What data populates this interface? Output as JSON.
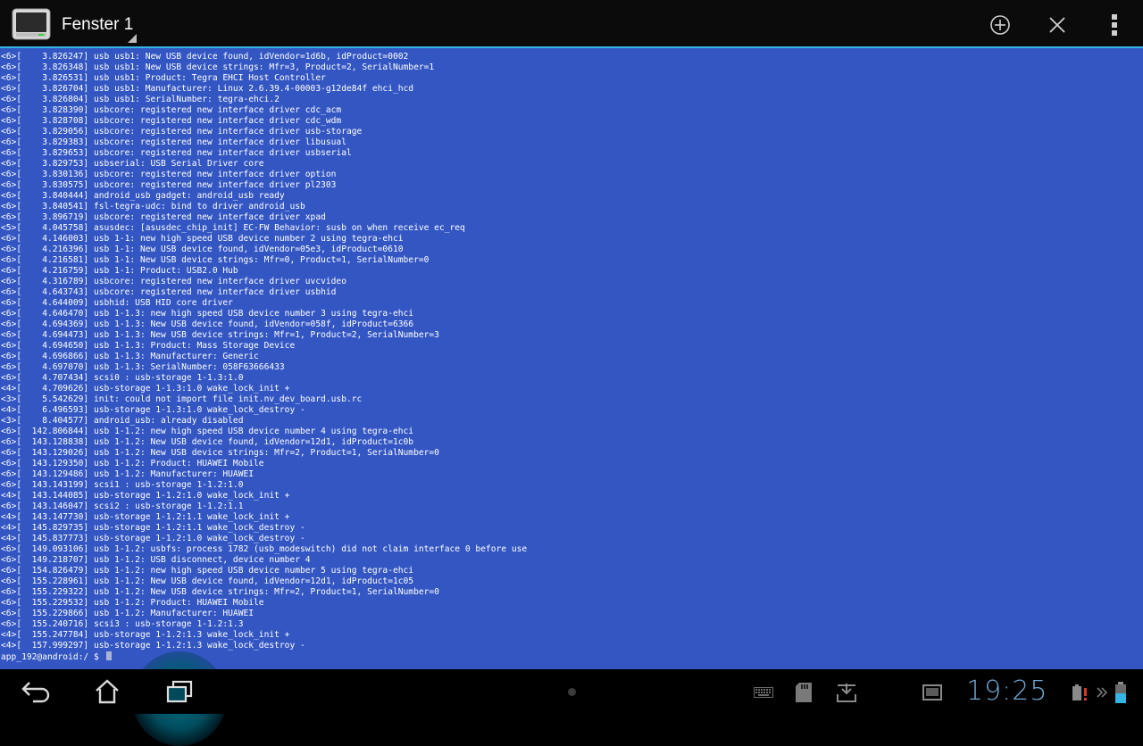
{
  "window": {
    "title": "Fenster 1"
  },
  "icons": {
    "app": "terminal-app-icon",
    "add": "plus-circle-icon",
    "close": "close-icon",
    "overflow": "overflow-menu-icon",
    "back": "back-icon",
    "home": "home-icon",
    "recents": "recent-apps-icon",
    "keyboard": "keyboard-icon",
    "sdcard": "sdcard-icon",
    "download": "download-icon",
    "screenshot": "screenshot-icon",
    "battery": "battery-icon"
  },
  "colors": {
    "terminal_bg": "#3356c3",
    "accent": "#33b5e5",
    "clock": "#6fa9d6"
  },
  "terminal": {
    "lines": [
      "<6>[    3.826247] usb usb1: New USB device found, idVendor=1d6b, idProduct=0002",
      "<6>[    3.826348] usb usb1: New USB device strings: Mfr=3, Product=2, SerialNumber=1",
      "<6>[    3.826531] usb usb1: Product: Tegra EHCI Host Controller",
      "<6>[    3.826704] usb usb1: Manufacturer: Linux 2.6.39.4-00003-g12de84f ehci_hcd",
      "<6>[    3.826804] usb usb1: SerialNumber: tegra-ehci.2",
      "<6>[    3.828390] usbcore: registered new interface driver cdc_acm",
      "<6>[    3.828708] usbcore: registered new interface driver cdc_wdm",
      "<6>[    3.829056] usbcore: registered new interface driver usb-storage",
      "<6>[    3.829383] usbcore: registered new interface driver libusual",
      "<6>[    3.829653] usbcore: registered new interface driver usbserial",
      "<6>[    3.829753] usbserial: USB Serial Driver core",
      "<6>[    3.830136] usbcore: registered new interface driver option",
      "<6>[    3.830575] usbcore: registered new interface driver pl2303",
      "<6>[    3.840444] android_usb gadget: android_usb ready",
      "<6>[    3.840541] fsl-tegra-udc: bind to driver android_usb",
      "<6>[    3.896719] usbcore: registered new interface driver xpad",
      "<5>[    4.045758] asusdec: [asusdec_chip_init] EC-FW Behavior: susb on when receive ec_req",
      "<6>[    4.146003] usb 1-1: new high speed USB device number 2 using tegra-ehci",
      "<6>[    4.216396] usb 1-1: New USB device found, idVendor=05e3, idProduct=0610",
      "<6>[    4.216581] usb 1-1: New USB device strings: Mfr=0, Product=1, SerialNumber=0",
      "<6>[    4.216759] usb 1-1: Product: USB2.0 Hub",
      "<6>[    4.316789] usbcore: registered new interface driver uvcvideo",
      "<6>[    4.643743] usbcore: registered new interface driver usbhid",
      "<6>[    4.644009] usbhid: USB HID core driver",
      "<6>[    4.646470] usb 1-1.3: new high speed USB device number 3 using tegra-ehci",
      "<6>[    4.694369] usb 1-1.3: New USB device found, idVendor=058f, idProduct=6366",
      "<6>[    4.694473] usb 1-1.3: New USB device strings: Mfr=1, Product=2, SerialNumber=3",
      "<6>[    4.694650] usb 1-1.3: Product: Mass Storage Device",
      "<6>[    4.696866] usb 1-1.3: Manufacturer: Generic",
      "<6>[    4.697070] usb 1-1.3: SerialNumber: 058F63666433",
      "<6>[    4.707434] scsi0 : usb-storage 1-1.3:1.0",
      "<4>[    4.709626] usb-storage 1-1.3:1.0 wake_lock_init +",
      "<3>[    5.542629] init: could not import file init.nv_dev_board.usb.rc",
      "<4>[    6.496593] usb-storage 1-1.3:1.0 wake_lock_destroy -",
      "<3>[    8.404577] android_usb: already disabled",
      "<6>[  142.806844] usb 1-1.2: new high speed USB device number 4 using tegra-ehci",
      "<6>[  143.128838] usb 1-1.2: New USB device found, idVendor=12d1, idProduct=1c0b",
      "<6>[  143.129026] usb 1-1.2: New USB device strings: Mfr=2, Product=1, SerialNumber=0",
      "<6>[  143.129350] usb 1-1.2: Product: HUAWEI Mobile",
      "<6>[  143.129486] usb 1-1.2: Manufacturer: HUAWEI",
      "<6>[  143.143199] scsi1 : usb-storage 1-1.2:1.0",
      "<4>[  143.144085] usb-storage 1-1.2:1.0 wake_lock_init +",
      "<6>[  143.146047] scsi2 : usb-storage 1-1.2:1.1",
      "<4>[  143.147730] usb-storage 1-1.2:1.1 wake_lock_init +",
      "<4>[  145.829735] usb-storage 1-1.2:1.1 wake_lock_destroy -",
      "<4>[  145.837773] usb-storage 1-1.2:1.0 wake_lock_destroy -",
      "<6>[  149.093106] usb 1-1.2: usbfs: process 1782 (usb_modeswitch) did not claim interface 0 before use",
      "<6>[  149.218707] usb 1-1.2: USB disconnect, device number 4",
      "<6>[  154.826479] usb 1-1.2: new high speed USB device number 5 using tegra-ehci",
      "<6>[  155.228961] usb 1-1.2: New USB device found, idVendor=12d1, idProduct=1c05",
      "<6>[  155.229322] usb 1-1.2: New USB device strings: Mfr=2, Product=1, SerialNumber=0",
      "<6>[  155.229532] usb 1-1.2: Product: HUAWEI Mobile",
      "<6>[  155.229866] usb 1-1.2: Manufacturer: HUAWEI",
      "<6>[  155.240716] scsi3 : usb-storage 1-1.2:1.3",
      "<4>[  155.247784] usb-storage 1-1.2:1.3 wake_lock_init +",
      "<4>[  157.999297] usb-storage 1-1.2:1.3 wake_lock_destroy -"
    ],
    "prompt": "app_192@android:/ $ "
  },
  "status": {
    "time": "19:25"
  }
}
